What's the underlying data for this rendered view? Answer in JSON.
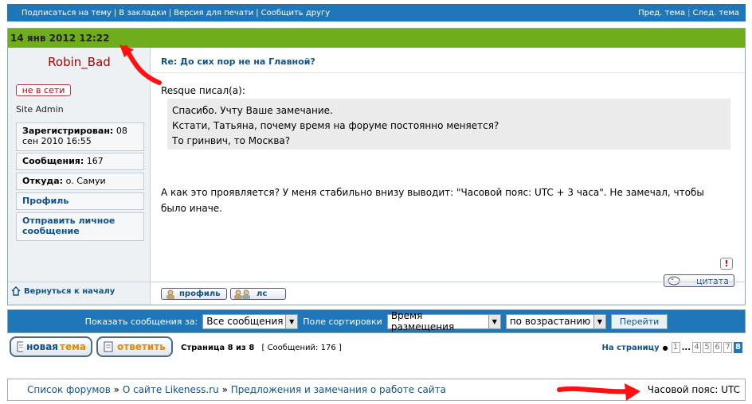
{
  "topbar": {
    "links": [
      "Подписаться на тему",
      "В закладки",
      "Версия для печати",
      "Сообщить другу"
    ],
    "prev_topic": "Пред. тема",
    "next_topic": "След. тема"
  },
  "post": {
    "datetime": "14 янв 2012 12:22",
    "subject": "Re: До сих пор не на Главной?",
    "quote_author": "Resque писал(а):",
    "quote_lines": [
      "Спасибо. Учту Ваше замечание.",
      "Кстати, Татьяна, почему время на форуме постоянно меняется?",
      "То гринвич, то Москва?"
    ],
    "message": "А как это проявляется? У меня стабильно внизу выводит: \"Часовой пояс: UTC + 3 часа\". Не замечал, чтобы было иначе.",
    "report_label": "!",
    "quote_button": "цитата",
    "profile_button": "профиль",
    "pm_button": "лс"
  },
  "author": {
    "name": "Robin_Bad",
    "status": "не в сети",
    "role": "Site Admin",
    "registered_label": "Зарегистрирован:",
    "registered_value": "08 сен 2010 16:55",
    "posts_label": "Сообщения:",
    "posts_value": "167",
    "from_label": "Откуда:",
    "from_value": "о. Самуи",
    "profile_link": "Профиль",
    "pm_link": "Отправить личное сообщение",
    "back_to_top": "Вернуться к началу"
  },
  "sortbar": {
    "show_label": "Показать сообщения за:",
    "show_value": "Все сообщения",
    "sort_label": "Поле сортировки",
    "sort_value": "Время размещения",
    "order_value": "по возрастанию",
    "go_button": "Перейти"
  },
  "actions": {
    "new_topic": "новая тема",
    "new_topic_accent": "тема",
    "new_topic_prefix": "новая",
    "reply": "ответить",
    "page_info": "Страница 8 из 8",
    "post_count": "[ Сообщений: 176 ]",
    "goto_page": "На страницу",
    "pages": [
      "1",
      "...",
      "4",
      "5",
      "6",
      "7",
      "8"
    ],
    "current_page": "8"
  },
  "footer": {
    "crumbs": [
      "Список форумов",
      "О сайте Likeness.ru",
      "Предложения и замечания о работе сайта"
    ],
    "crumb_sep": "»",
    "timezone": "Часовой пояс: UTC"
  },
  "colors": {
    "header_blue": "#1f76b9",
    "date_green": "#70ad1c",
    "username_red": "#aa0000",
    "annotation_red": "#ff1111"
  }
}
